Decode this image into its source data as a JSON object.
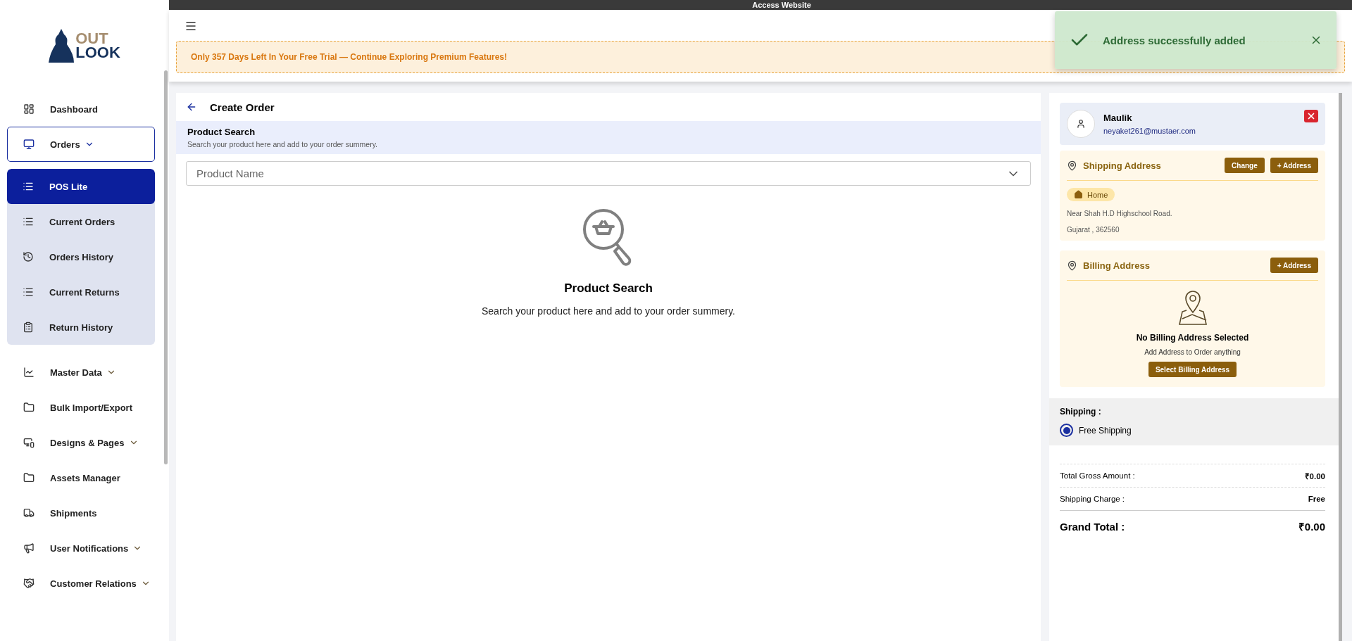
{
  "top_bar": {
    "label": "Access Website"
  },
  "sidebar": {
    "logo": {
      "line_1": "OUT",
      "line_2": "LOOK"
    },
    "items": [
      {
        "label": "Dashboard",
        "selected": false
      },
      {
        "label": "Orders",
        "selected": true,
        "expanded": true,
        "children": [
          {
            "label": "POS Lite",
            "selected": true
          },
          {
            "label": "Current Orders",
            "selected": false
          },
          {
            "label": "Orders History",
            "selected": false
          },
          {
            "label": "Current Returns",
            "selected": false
          },
          {
            "label": "Return History",
            "selected": false
          }
        ]
      },
      {
        "label": "Master Data",
        "selected": false,
        "expanded": false
      },
      {
        "label": "Bulk Import/Export",
        "selected": false
      },
      {
        "label": "Designs & Pages",
        "selected": false,
        "expanded": false
      },
      {
        "label": "Assets Manager",
        "selected": false
      },
      {
        "label": "Shipments",
        "selected": false
      },
      {
        "label": "User Notifications",
        "selected": false,
        "expanded": false
      },
      {
        "label": "Customer Relations",
        "selected": false,
        "expanded": false
      }
    ]
  },
  "header": {
    "trial_banner": "Only 357 Days Left In Your Free Trial — Continue Exploring Premium Features!"
  },
  "toast": {
    "kind": "success",
    "message": "Address successfully added"
  },
  "create_order": {
    "title": "Create Order",
    "section_title": "Product Search",
    "section_subtitle": "Search your product here and add to your order summery.",
    "product_select": {
      "placeholder": "Product Name"
    },
    "empty_title": "Product Search",
    "empty_text": "Search your product here and add to your order summery."
  },
  "customer": {
    "name": "Maulik",
    "email": "neyaket261@mustaer.com"
  },
  "shipping_address": {
    "title": "Shipping Address",
    "buttons": [
      "Change",
      "+ Address"
    ],
    "tag": "Home",
    "lines": [
      "Near Shah H.D Highschool Road.",
      "Gujarat , 362560"
    ]
  },
  "billing_address": {
    "title": "Billing Address",
    "buttons": [
      "+ Address"
    ],
    "empty_title": "No Billing Address Selected",
    "empty_text": "Add Address to Order anything",
    "select_button": "Select Billing Address"
  },
  "shipping": {
    "title": "Shipping :",
    "options": [
      {
        "label": "Free Shipping",
        "selected": true
      }
    ]
  },
  "totals": [
    {
      "kind": "row",
      "label": "Total Gross Amount :",
      "value": "₹0.00"
    },
    {
      "kind": "row",
      "label": "Shipping Charge :",
      "value": "Free"
    },
    {
      "kind": "grand",
      "label": "Grand Total :",
      "value": "₹0.00"
    }
  ]
}
